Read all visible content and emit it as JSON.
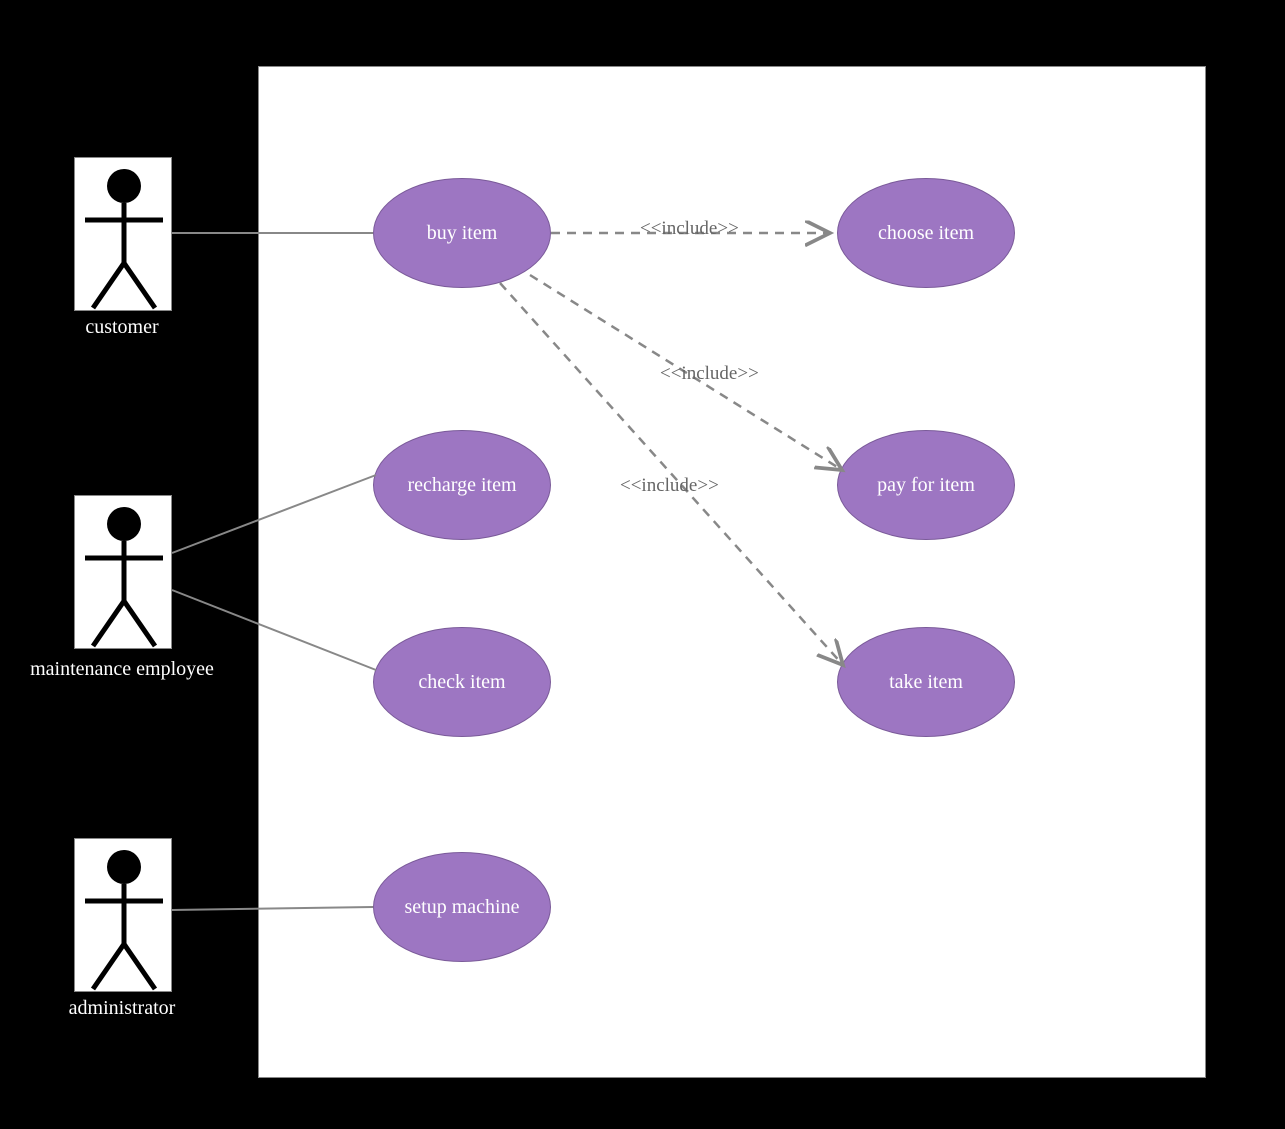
{
  "actors": {
    "customer": "customer",
    "maintenance": "maintenance employee",
    "administrator": "administrator"
  },
  "usecases": {
    "buy_item": "buy item",
    "recharge_item": "recharge item",
    "check_item": "check item",
    "setup_machine": "setup machine",
    "choose_item": "choose item",
    "pay_for_item": "pay for item",
    "take_item": "take item"
  },
  "relationships": {
    "include1": "<<include>>",
    "include2": "<<include>>",
    "include3": "<<include>>"
  }
}
